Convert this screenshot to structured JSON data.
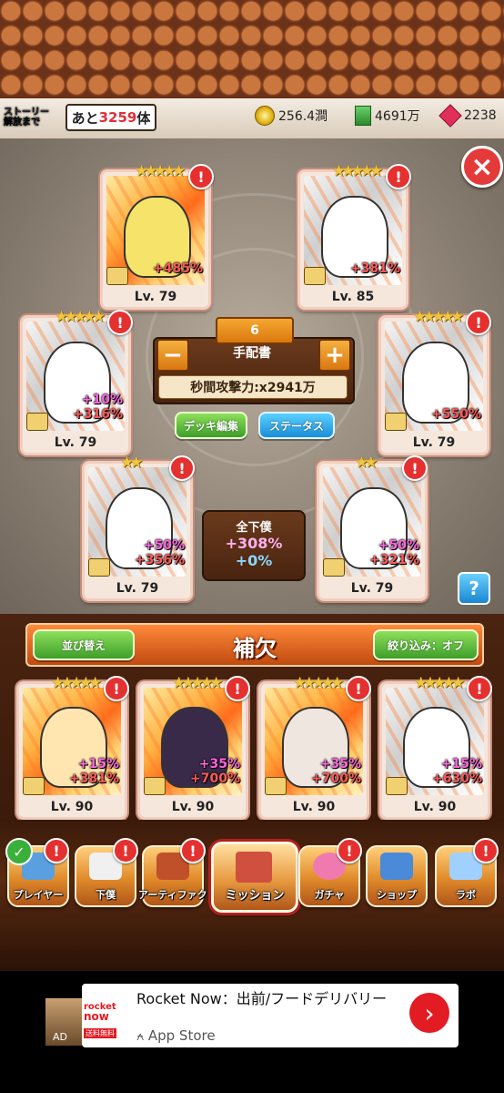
{
  "header": {
    "story_label_line1": "ストーリー",
    "story_label_line2": "解放まで",
    "remaining_prefix": "あと",
    "remaining_count": "3259",
    "remaining_suffix": "体",
    "coins": "256.4澗",
    "books": "4691万",
    "gems": "2238"
  },
  "deck": {
    "count": "6",
    "name": "手配書",
    "attack": "秒間攻撃力:x2941万",
    "deck_edit_label": "デッキ編集",
    "status_label": "ステータス",
    "summary_title": "全下僕",
    "summary_bonus_a": "+308%",
    "summary_bonus_b": "+0%",
    "help": "?",
    "close": "×"
  },
  "deck_cards": [
    {
      "stars": "★★★★★",
      "bonus_pink": "",
      "bonus_red": "+485%",
      "level": "Lv. 79",
      "color": true
    },
    {
      "stars": "★★★★★",
      "bonus_pink": "",
      "bonus_red": "+381%",
      "level": "Lv. 85",
      "color": false
    },
    {
      "stars": "★★★★★",
      "bonus_pink": "+10%",
      "bonus_red": "+316%",
      "level": "Lv. 79",
      "color": false
    },
    {
      "stars": "★★★★★",
      "bonus_pink": "",
      "bonus_red": "+550%",
      "level": "Lv. 79",
      "color": false
    },
    {
      "stars": "★★",
      "bonus_pink": "+50%",
      "bonus_red": "+356%",
      "level": "Lv. 79",
      "color": false
    },
    {
      "stars": "★★",
      "bonus_pink": "+50%",
      "bonus_red": "+321%",
      "level": "Lv. 79",
      "color": false
    }
  ],
  "reserve": {
    "title": "補欠",
    "sort_label": "並び替え",
    "filter_label": "絞り込み：オフ",
    "cards": [
      {
        "stars": "★★★★★",
        "bonus_pink": "+15%",
        "bonus_red": "+381%",
        "level": "Lv. 90"
      },
      {
        "stars": "★★★★★",
        "bonus_pink": "+35%",
        "bonus_red": "+700%",
        "level": "Lv. 90"
      },
      {
        "stars": "★★★★★",
        "bonus_pink": "+35%",
        "bonus_red": "+700%",
        "level": "Lv. 90"
      },
      {
        "stars": "★★★★★",
        "bonus_pink": "+15%",
        "bonus_red": "+630%",
        "level": "Lv. 90"
      }
    ]
  },
  "nav": {
    "player": "プレイヤー",
    "servants": "下僕",
    "artifact": "アーティファクト",
    "mission": "ミッション",
    "gacha": "ガチャ",
    "shop": "ショップ",
    "lab": "ラボ"
  },
  "ad": {
    "title": "Rocket Now：出前/フードデリバリー",
    "store": "App Store",
    "logo_line1": "rocket",
    "logo_line2": "now",
    "logo_line3": "送料無料",
    "badge": "AD"
  }
}
